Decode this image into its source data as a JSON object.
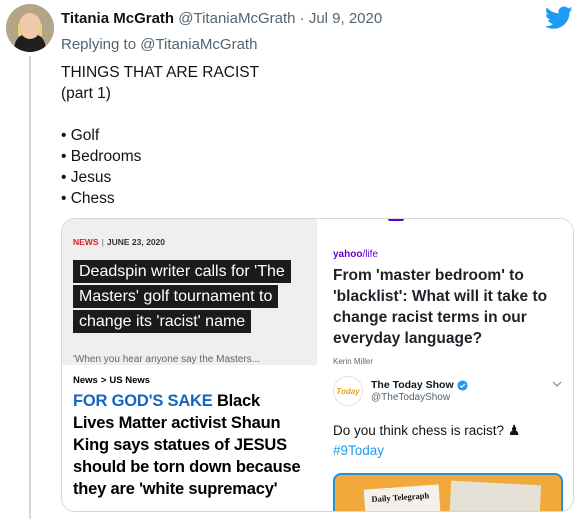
{
  "tweet": {
    "display_name": "Titania McGrath",
    "handle": "@TitaniaMcGrath",
    "separator": "·",
    "date": "Jul 9, 2020",
    "replying_prefix": "Replying to",
    "replying_handle": "@TitaniaMcGrath",
    "text_line1": "THINGS THAT ARE RACIST",
    "text_line2": "(part 1)",
    "list": [
      "• Golf",
      "• Bedrooms",
      "• Jesus",
      "• Chess"
    ]
  },
  "media": {
    "deadspin": {
      "kicker_news": "NEWS",
      "kicker_sep": "|",
      "kicker_date": "JUNE 23, 2020",
      "headline": "Deadspin writer calls for 'The Masters' golf tournament to change its 'racist' name",
      "sub_text": "'When you hear anyone say the Masters..."
    },
    "yahoo": {
      "brand_yahoo": "yahoo",
      "brand_life": "/life",
      "headline": "From 'master bedroom' to 'blacklist': What will it take to change racist terms in our everyday language?",
      "author": "Kerin Miller"
    },
    "dailymail": {
      "crumb_news": "News",
      "crumb_chevron": ">",
      "crumb_section": "US News",
      "headline_highlight": "FOR GOD'S SAKE",
      "headline_rest": " Black Lives Matter activist Shaun King says statues of JESUS should be torn down because they are 'white supremacy'"
    },
    "todayshow": {
      "logo_text": "Today",
      "account_name": "The Today Show",
      "account_handle": "@TheTodayShow",
      "text": "Do you think chess is racist?",
      "pawn": "♟",
      "hashtag": "#9Today",
      "paper_title": "Daily Telegraph"
    }
  },
  "colors": {
    "twitter_blue": "#1d9bf0",
    "news_red": "#d3231c",
    "yahoo_purple": "#5f01d1",
    "dailymail_blue": "#1565c0"
  }
}
